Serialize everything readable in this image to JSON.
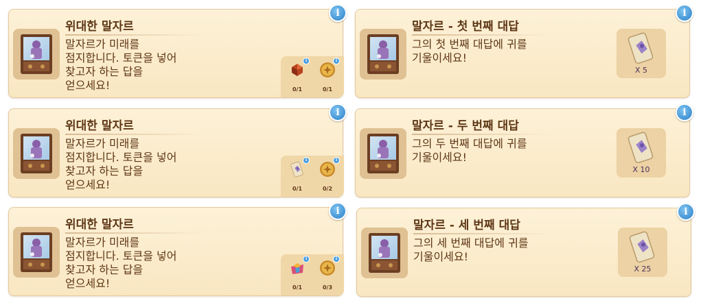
{
  "quests": [
    {
      "title": "위대한 말자르",
      "description": "말자르가 미래를\n점지합니다. 토큰을 넣어\n찾고자 하는 답을\n얻으세요!",
      "requirements": [
        {
          "icon": "ruby-gem-icon",
          "count": "0/1"
        },
        {
          "icon": "gold-coin-icon",
          "count": "0/1"
        }
      ]
    },
    {
      "title": "말자르 - 첫 번째 대답",
      "description": "그의 첫 번째 대답에 귀를\n기울이세요!",
      "reward": {
        "icon": "fortune-card-icon",
        "count": "X 5"
      }
    },
    {
      "title": "위대한 말자르",
      "description": "말자르가 미래를\n점지합니다. 토큰을 넣어\n찾고자 하는 답을\n얻으세요!",
      "requirements": [
        {
          "icon": "fortune-card-icon",
          "count": "0/1"
        },
        {
          "icon": "gold-coin-icon",
          "count": "0/2"
        }
      ]
    },
    {
      "title": "말자르 - 두 번째 대답",
      "description": "그의 두 번째 대답에 귀를\n기울이세요!",
      "reward": {
        "icon": "fortune-card-icon",
        "count": "X 10"
      }
    },
    {
      "title": "위대한 말자르",
      "description": "말자르가 미래를\n점지합니다. 토큰을 넣어\n찾고자 하는 답을\n얻으세요!",
      "requirements": [
        {
          "icon": "colorful-gift-icon",
          "count": "0/1"
        },
        {
          "icon": "gold-coin-icon",
          "count": "0/3"
        }
      ]
    },
    {
      "title": "말자르 - 세 번째 대답",
      "description": "그의 세 번째 대답에 귀를\n기울이세요!",
      "reward": {
        "icon": "fortune-card-icon",
        "count": "X 25"
      }
    }
  ],
  "info_label": "i",
  "colors": {
    "card_bg": "#fbecd0",
    "text": "#5e3716",
    "info_blue": "#2a7fc9",
    "reward_text": "#4a2e5a"
  }
}
